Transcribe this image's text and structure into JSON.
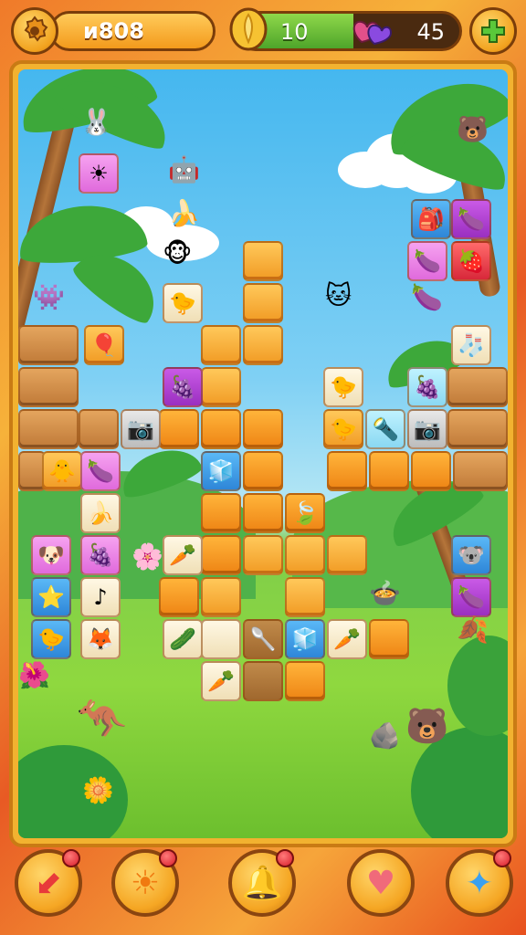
{
  "hud": {
    "score_text": "ᴎ808",
    "progress_left": "10",
    "progress_right": "45",
    "progress_fraction": 0.52,
    "icons": {
      "settings": "gear-icon",
      "coin": "coin-icon",
      "hearts": "heart-icon",
      "add": "plus-icon"
    },
    "accent_color": "#f39a1c",
    "progress_color": "#4ea52a"
  },
  "board": {
    "tiles": [
      {
        "kind": "sun",
        "glyph": "☀",
        "style": "t-pink"
      },
      {
        "kind": "bird",
        "glyph": "🐤",
        "style": "t-cream"
      },
      {
        "kind": "balloon",
        "glyph": "🎈",
        "style": "t-gold"
      },
      {
        "kind": "plum",
        "glyph": "🍇",
        "style": "t-purple"
      },
      {
        "kind": "camera",
        "glyph": "📷",
        "style": "t-gray"
      },
      {
        "kind": "blue-box",
        "glyph": "🧊",
        "style": "t-blue"
      },
      {
        "kind": "bird",
        "glyph": "🐥",
        "style": "t-gold"
      },
      {
        "kind": "plum",
        "glyph": "🍆",
        "style": "t-pink"
      },
      {
        "kind": "banana",
        "glyph": "🍌",
        "style": "t-cream"
      },
      {
        "kind": "dog",
        "glyph": "🐶",
        "style": "t-pink"
      },
      {
        "kind": "plum",
        "glyph": "🍇",
        "style": "t-pink"
      },
      {
        "kind": "starfish",
        "glyph": "⭐",
        "style": "t-blue"
      },
      {
        "kind": "note",
        "glyph": "♪",
        "style": "t-cream"
      },
      {
        "kind": "bird",
        "glyph": "🐤",
        "style": "t-blue"
      },
      {
        "kind": "fox",
        "glyph": "🦊",
        "style": "t-cream"
      },
      {
        "kind": "carrot",
        "glyph": "🥕",
        "style": "t-cream"
      },
      {
        "kind": "leaf",
        "glyph": "🍃",
        "style": "t-orange"
      },
      {
        "kind": "leaf",
        "glyph": "🥒",
        "style": "t-cream"
      },
      {
        "kind": "spoon",
        "glyph": "🥄",
        "style": "t-brown"
      },
      {
        "kind": "blue-box",
        "glyph": "🧊",
        "style": "t-blue"
      },
      {
        "kind": "carrot",
        "glyph": "🥕",
        "style": "t-cream"
      },
      {
        "kind": "carrot",
        "glyph": "🥕",
        "style": "t-cream"
      },
      {
        "kind": "bird",
        "glyph": "🐤",
        "style": "t-cream"
      },
      {
        "kind": "leaf",
        "glyph": "🐤",
        "style": "t-gold"
      },
      {
        "kind": "plum",
        "glyph": "🍇",
        "style": "t-cyan"
      },
      {
        "kind": "plum",
        "glyph": "🍆",
        "style": "t-purple"
      },
      {
        "kind": "whistle",
        "glyph": "🔦",
        "style": "t-cyan"
      },
      {
        "kind": "camera",
        "glyph": "📷",
        "style": "t-gray"
      },
      {
        "kind": "sock",
        "glyph": "🧦",
        "style": "t-cream"
      },
      {
        "kind": "blue-bag",
        "glyph": "🎒",
        "style": "t-blue"
      },
      {
        "kind": "plum",
        "glyph": "🍆",
        "style": "t-purple"
      },
      {
        "kind": "strawberry",
        "glyph": "🍓",
        "style": "t-red"
      },
      {
        "kind": "koala",
        "glyph": "🐨",
        "style": "t-blue"
      },
      {
        "kind": "plum",
        "glyph": "🍆",
        "style": "t-pink"
      }
    ]
  },
  "bottom_bar": {
    "buttons": [
      {
        "name": "undo-button",
        "icon": "arrow-left-icon",
        "glyph": "⬋"
      },
      {
        "name": "sun-button",
        "icon": "sun-icon",
        "glyph": "☀"
      },
      {
        "name": "hint-button",
        "icon": "bell-icon",
        "glyph": "🔔"
      },
      {
        "name": "heart-button",
        "icon": "heart-icon",
        "glyph": "♥"
      },
      {
        "name": "shuffle-button",
        "icon": "star-icon",
        "glyph": "✦"
      }
    ]
  }
}
